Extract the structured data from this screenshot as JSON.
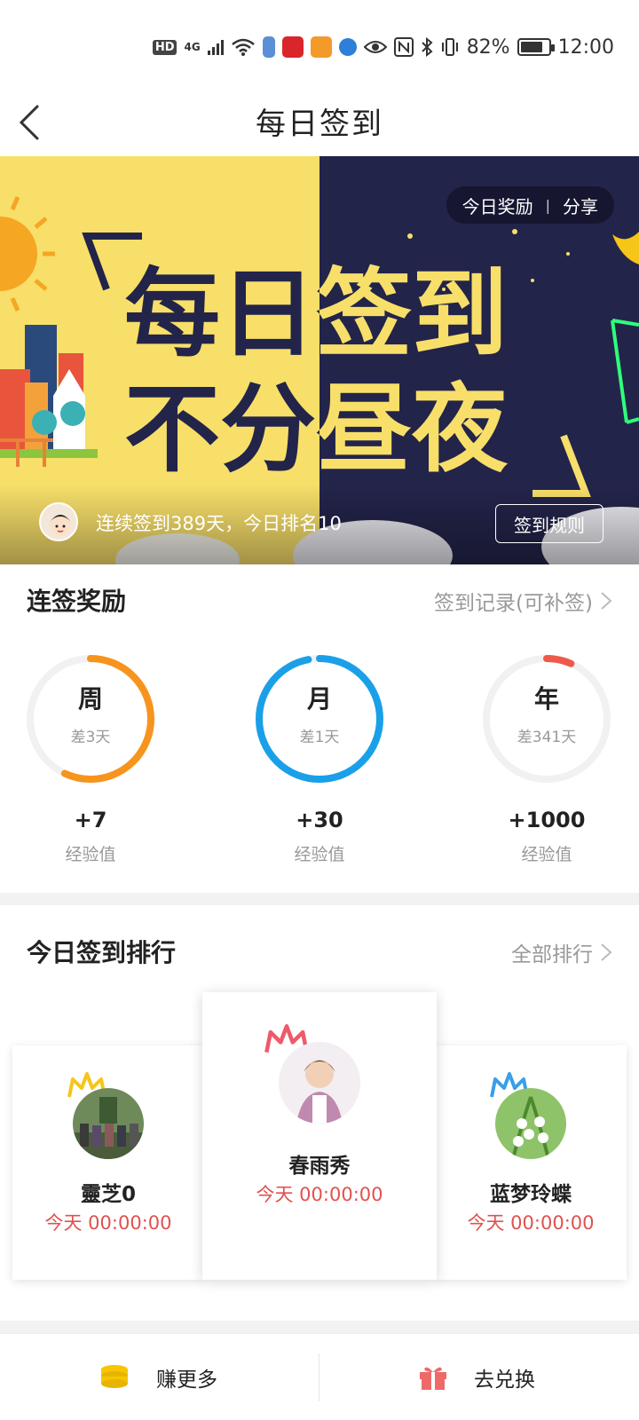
{
  "status_bar": {
    "hd": "HD",
    "network": "4G",
    "battery_percent": "82%",
    "battery_level": 0.82,
    "time": "12:00"
  },
  "nav": {
    "title": "每日签到",
    "back_icon": "chevron-left-icon"
  },
  "banner": {
    "headline_line1": "每日签到",
    "headline_line2": "不分昼夜",
    "pill_left": "今日奖励",
    "pill_sep": "|",
    "pill_right": "分享",
    "streak_text": "连续签到389天，今日排名10",
    "rules_button": "签到规则"
  },
  "streak": {
    "title": "连签奖励",
    "link": "签到记录(可补签)",
    "items": [
      {
        "label": "周",
        "remaining": "差3天",
        "reward": "+7",
        "unit": "经验值",
        "progress": 0.57,
        "color": "#f7941d"
      },
      {
        "label": "月",
        "remaining": "差1天",
        "reward": "+30",
        "unit": "经验值",
        "progress": 0.97,
        "color": "#1aa0e8"
      },
      {
        "label": "年",
        "remaining": "差341天",
        "reward": "+1000",
        "unit": "经验值",
        "progress": 0.066,
        "color": "#ee5a4a"
      }
    ]
  },
  "ranking": {
    "title": "今日签到排行",
    "link": "全部排行",
    "entries": [
      {
        "rank": 2,
        "name": "靈芝0",
        "time": "今天 00:00:00",
        "crown_color": "#f5c518"
      },
      {
        "rank": 1,
        "name": "春雨秀",
        "time": "今天 00:00:00",
        "crown_color": "#ee5a6a"
      },
      {
        "rank": 3,
        "name": "蓝梦玲蝶",
        "time": "今天 00:00:00",
        "crown_color": "#3a9ee8"
      }
    ]
  },
  "bottom_bar": {
    "earn_label": "赚更多",
    "redeem_label": "去兑换",
    "earn_icon": "coin-stack-icon",
    "redeem_icon": "gift-icon"
  },
  "colors": {
    "accent_red": "#e0524f",
    "banner_yellow": "#f7df6a",
    "banner_navy": "#23244a"
  }
}
